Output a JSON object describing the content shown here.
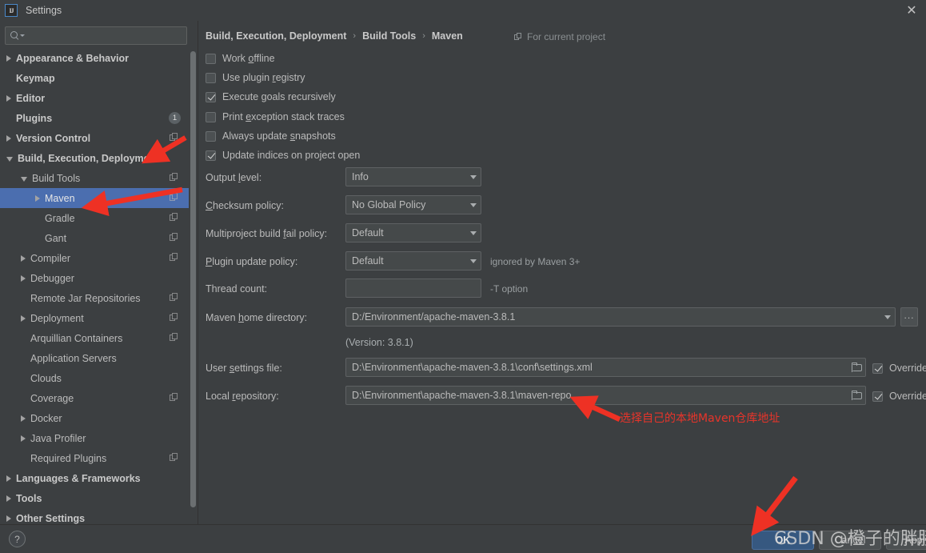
{
  "window": {
    "title": "Settings",
    "logo_text": "IJ",
    "close_label": "✕"
  },
  "search": {
    "value": "",
    "placeholder": ""
  },
  "sidebar": {
    "items": [
      {
        "label": "Appearance & Behavior",
        "indent": 0,
        "arrow": "right",
        "bold": true,
        "copy": false,
        "badge": null,
        "selected": false
      },
      {
        "label": "Keymap",
        "indent": 0,
        "arrow": "none",
        "bold": true,
        "copy": false,
        "badge": null,
        "selected": false
      },
      {
        "label": "Editor",
        "indent": 0,
        "arrow": "right",
        "bold": true,
        "copy": false,
        "badge": null,
        "selected": false
      },
      {
        "label": "Plugins",
        "indent": 0,
        "arrow": "none",
        "bold": true,
        "copy": false,
        "badge": "1",
        "selected": false
      },
      {
        "label": "Version Control",
        "indent": 0,
        "arrow": "right",
        "bold": true,
        "copy": true,
        "badge": null,
        "selected": false
      },
      {
        "label": "Build, Execution, Deployment",
        "indent": 0,
        "arrow": "down",
        "bold": true,
        "copy": false,
        "badge": null,
        "selected": false
      },
      {
        "label": "Build Tools",
        "indent": 1,
        "arrow": "down",
        "bold": false,
        "copy": true,
        "badge": null,
        "selected": false
      },
      {
        "label": "Maven",
        "indent": 2,
        "arrow": "right",
        "bold": false,
        "copy": true,
        "badge": null,
        "selected": true
      },
      {
        "label": "Gradle",
        "indent": 2,
        "arrow": "none",
        "bold": false,
        "copy": true,
        "badge": null,
        "selected": false
      },
      {
        "label": "Gant",
        "indent": 2,
        "arrow": "none",
        "bold": false,
        "copy": true,
        "badge": null,
        "selected": false
      },
      {
        "label": "Compiler",
        "indent": 1,
        "arrow": "right",
        "bold": false,
        "copy": true,
        "badge": null,
        "selected": false
      },
      {
        "label": "Debugger",
        "indent": 1,
        "arrow": "right",
        "bold": false,
        "copy": false,
        "badge": null,
        "selected": false
      },
      {
        "label": "Remote Jar Repositories",
        "indent": 1,
        "arrow": "none",
        "bold": false,
        "copy": true,
        "badge": null,
        "selected": false
      },
      {
        "label": "Deployment",
        "indent": 1,
        "arrow": "right",
        "bold": false,
        "copy": true,
        "badge": null,
        "selected": false
      },
      {
        "label": "Arquillian Containers",
        "indent": 1,
        "arrow": "none",
        "bold": false,
        "copy": true,
        "badge": null,
        "selected": false
      },
      {
        "label": "Application Servers",
        "indent": 1,
        "arrow": "none",
        "bold": false,
        "copy": false,
        "badge": null,
        "selected": false
      },
      {
        "label": "Clouds",
        "indent": 1,
        "arrow": "none",
        "bold": false,
        "copy": false,
        "badge": null,
        "selected": false
      },
      {
        "label": "Coverage",
        "indent": 1,
        "arrow": "none",
        "bold": false,
        "copy": true,
        "badge": null,
        "selected": false
      },
      {
        "label": "Docker",
        "indent": 1,
        "arrow": "right",
        "bold": false,
        "copy": false,
        "badge": null,
        "selected": false
      },
      {
        "label": "Java Profiler",
        "indent": 1,
        "arrow": "right",
        "bold": false,
        "copy": false,
        "badge": null,
        "selected": false
      },
      {
        "label": "Required Plugins",
        "indent": 1,
        "arrow": "none",
        "bold": false,
        "copy": true,
        "badge": null,
        "selected": false
      },
      {
        "label": "Languages & Frameworks",
        "indent": 0,
        "arrow": "right",
        "bold": true,
        "copy": false,
        "badge": null,
        "selected": false
      },
      {
        "label": "Tools",
        "indent": 0,
        "arrow": "right",
        "bold": true,
        "copy": false,
        "badge": null,
        "selected": false
      },
      {
        "label": "Other Settings",
        "indent": 0,
        "arrow": "right",
        "bold": true,
        "copy": false,
        "badge": null,
        "selected": false
      }
    ]
  },
  "content": {
    "breadcrumb": {
      "root": "Build, Execution, Deployment",
      "mid": "Build Tools",
      "leaf": "Maven",
      "separator": "›"
    },
    "for_current_project": "For current project",
    "checkboxes": [
      {
        "label_pre": "Work ",
        "label_mn": "o",
        "label_post": "ffline",
        "checked": false
      },
      {
        "label_pre": "Use plugin ",
        "label_mn": "r",
        "label_post": "egistry",
        "checked": false
      },
      {
        "label_pre": "Execute ",
        "label_mn": "g",
        "label_post": "oals recursively",
        "checked": true
      },
      {
        "label_pre": "Print ",
        "label_mn": "e",
        "label_post": "xception stack traces",
        "checked": false
      },
      {
        "label_pre": "Always update ",
        "label_mn": "s",
        "label_post": "napshots",
        "checked": false
      },
      {
        "label_pre": "Update indices on project open",
        "label_mn": "",
        "label_post": "",
        "checked": true
      }
    ],
    "fields": {
      "output_level": {
        "label_pre": "Output ",
        "label_mn": "l",
        "label_post": "evel:",
        "value": "Info"
      },
      "checksum_policy": {
        "label_pre": "",
        "label_mn": "C",
        "label_post": "hecksum policy:",
        "value": "No Global Policy"
      },
      "multiproject_fail": {
        "label_pre": "Multiproject build ",
        "label_mn": "f",
        "label_post": "ail policy:",
        "value": "Default"
      },
      "plugin_update": {
        "label_pre": "",
        "label_mn": "P",
        "label_post": "lugin update policy:",
        "value": "Default",
        "hint": "ignored by Maven 3+"
      },
      "thread_count": {
        "label_pre": "Thread count:",
        "label_mn": "",
        "label_post": "",
        "value": "",
        "hint": "-T option"
      },
      "maven_home": {
        "label_pre": "Maven ",
        "label_mn": "h",
        "label_post": "ome directory:",
        "value": "D:/Environment/apache-maven-3.8.1",
        "ellipsis": "..."
      },
      "version_note": "(Version: 3.8.1)",
      "user_settings": {
        "label_pre": "User ",
        "label_mn": "s",
        "label_post": "ettings file:",
        "value": "D:\\Environment\\apache-maven-3.8.1\\conf\\settings.xml",
        "override_label": "Override",
        "override_checked": true
      },
      "local_repository": {
        "label_pre": "Local ",
        "label_mn": "r",
        "label_post": "epository:",
        "value": "D:\\Environment\\apache-maven-3.8.1\\maven-repo",
        "override_label": "Override",
        "override_checked": true
      }
    }
  },
  "bottom": {
    "help_label": "?",
    "ok_label": "OK",
    "cancel_label": "Cancel",
    "apply_label": "Apply"
  },
  "annotations": {
    "local_repo_note": "选择自己的本地Maven仓库地址",
    "watermark": "CSDN @橙子的胖胖"
  },
  "colors": {
    "window_bg": "#3c3f41",
    "selection": "#4b6eaf",
    "field_bg": "#45494a",
    "accent_button": "#365880",
    "annotation_red": "#e8342a"
  }
}
